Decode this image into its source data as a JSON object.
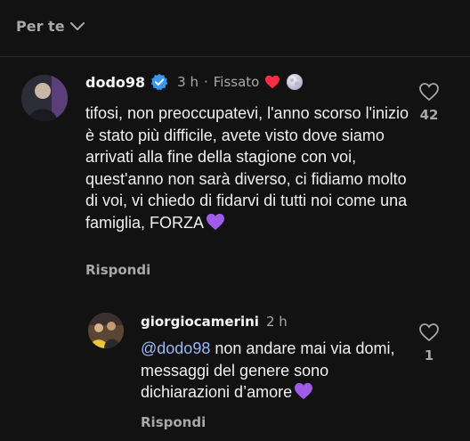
{
  "sort": {
    "label": "Per te"
  },
  "main_comment": {
    "username": "dodo98",
    "time": "3 h",
    "separator": "·",
    "pinned": "Fissato",
    "text": "tifosi, non preoccupatevi, l'anno scorso l'inizio è stato più difficile, avete visto dove siamo arrivati alla fine della stagione con voi, quest'anno non sarà diverso, ci fidiamo molto di voi, vi chiedo di fidarvi di tutti noi come una famiglia, FORZA",
    "reply_label": "Rispondi",
    "likes": "42",
    "verified": true
  },
  "reply_comment": {
    "username": "giorgiocamerini",
    "time": "2 h",
    "mention": "@dodo98",
    "text": " non andare mai via domi, messaggi del genere sono dichiarazioni d’amore",
    "reply_label": "Rispondi",
    "likes": "1"
  },
  "colors": {
    "background": "#121212",
    "verified": "#3897f0",
    "mention": "#9bb8f0",
    "purple_heart": "#a05ce8",
    "red_heart": "#ff2d40"
  },
  "icons": {
    "sort": "chevron-down-icon",
    "verified": "verified-badge-icon",
    "pinned_heart": "red-heart-icon",
    "moon": "moon-icon",
    "like": "heart-outline-icon",
    "emoji": "purple-heart-icon"
  }
}
